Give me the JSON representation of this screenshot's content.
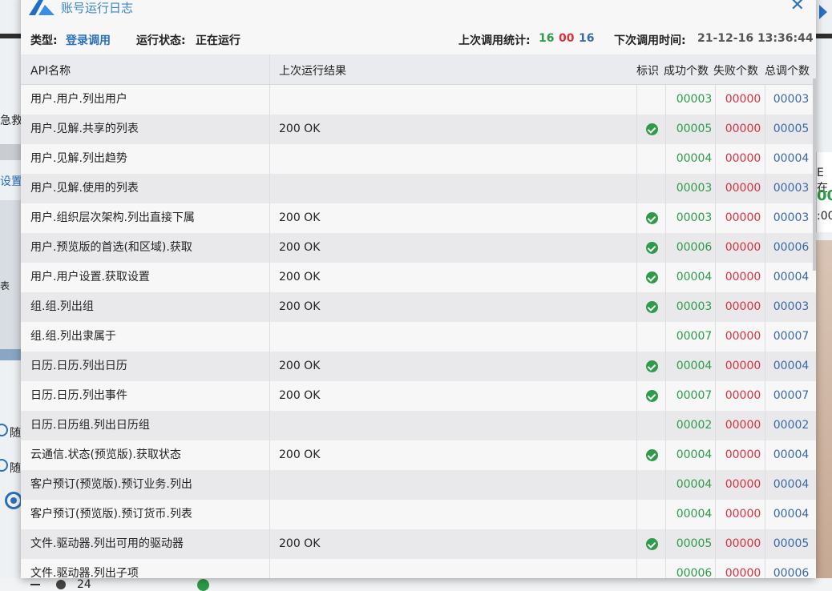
{
  "window": {
    "title": "账号运行日志"
  },
  "info": {
    "type_label": "类型:",
    "type_value": "登录调用",
    "status_label": "运行状态:",
    "status_value": "正在运行",
    "last_stats_label": "上次调用统计:",
    "last_ok": "16",
    "last_fail": "00",
    "last_total": "16",
    "next_label": "下次调用时间:",
    "next_value": "21-12-16 13:36:44"
  },
  "columns": {
    "name": "API名称",
    "result": "上次运行结果",
    "flag": "标识",
    "ok": "成功个数",
    "fail": "失败个数",
    "total": "总调个数"
  },
  "rows": [
    {
      "name": "用户.用户.列出用户",
      "result": "",
      "ok": "00003",
      "fail": "00000",
      "total": "00003",
      "checked": false
    },
    {
      "name": "用户.见解.共享的列表",
      "result": "200 OK",
      "ok": "00005",
      "fail": "00000",
      "total": "00005",
      "checked": true
    },
    {
      "name": "用户.见解.列出趋势",
      "result": "",
      "ok": "00004",
      "fail": "00000",
      "total": "00004",
      "checked": false
    },
    {
      "name": "用户.见解.使用的列表",
      "result": "",
      "ok": "00003",
      "fail": "00000",
      "total": "00003",
      "checked": false
    },
    {
      "name": "用户.组织层次架构.列出直接下属",
      "result": "200 OK",
      "ok": "00003",
      "fail": "00000",
      "total": "00003",
      "checked": true
    },
    {
      "name": "用户.预览版的首选(和区域).获取",
      "result": "200 OK",
      "ok": "00006",
      "fail": "00000",
      "total": "00006",
      "checked": true
    },
    {
      "name": "用户.用户设置.获取设置",
      "result": "200 OK",
      "ok": "00004",
      "fail": "00000",
      "total": "00004",
      "checked": true
    },
    {
      "name": "组.组.列出组",
      "result": "200 OK",
      "ok": "00003",
      "fail": "00000",
      "total": "00003",
      "checked": true
    },
    {
      "name": "组.组.列出隶属于",
      "result": "",
      "ok": "00007",
      "fail": "00000",
      "total": "00007",
      "checked": false
    },
    {
      "name": "日历.日历.列出日历",
      "result": "200 OK",
      "ok": "00004",
      "fail": "00000",
      "total": "00004",
      "checked": true
    },
    {
      "name": "日历.日历.列出事件",
      "result": "200 OK",
      "ok": "00007",
      "fail": "00000",
      "total": "00007",
      "checked": true
    },
    {
      "name": "日历.日历组.列出日历组",
      "result": "",
      "ok": "00002",
      "fail": "00000",
      "total": "00002",
      "checked": false
    },
    {
      "name": "云通信.状态(预览版).获取状态",
      "result": "200 OK",
      "ok": "00004",
      "fail": "00000",
      "total": "00004",
      "checked": true
    },
    {
      "name": "客户预订(预览版).预订业务.列出",
      "result": "",
      "ok": "00004",
      "fail": "00000",
      "total": "00004",
      "checked": false
    },
    {
      "name": "客户预订(预览版).预订货币.列表",
      "result": "",
      "ok": "00004",
      "fail": "00000",
      "total": "00004",
      "checked": false
    },
    {
      "name": "文件.驱动器.列出可用的驱动器",
      "result": "200 OK",
      "ok": "00005",
      "fail": "00000",
      "total": "00005",
      "checked": true
    },
    {
      "name": "文件.驱动器.列出子项",
      "result": "",
      "ok": "00006",
      "fail": "00000",
      "total": "00006",
      "checked": false
    }
  ],
  "background": {
    "left_fragments": [
      "急救",
      "设置",
      "表",
      "随",
      "随"
    ],
    "right_fragments": [
      "E在",
      "00",
      ":00:0"
    ],
    "bottom_number": "24"
  },
  "icons": {
    "logo": "azure-logo-icon",
    "close": "close-icon",
    "flag": "check-circle-icon"
  }
}
